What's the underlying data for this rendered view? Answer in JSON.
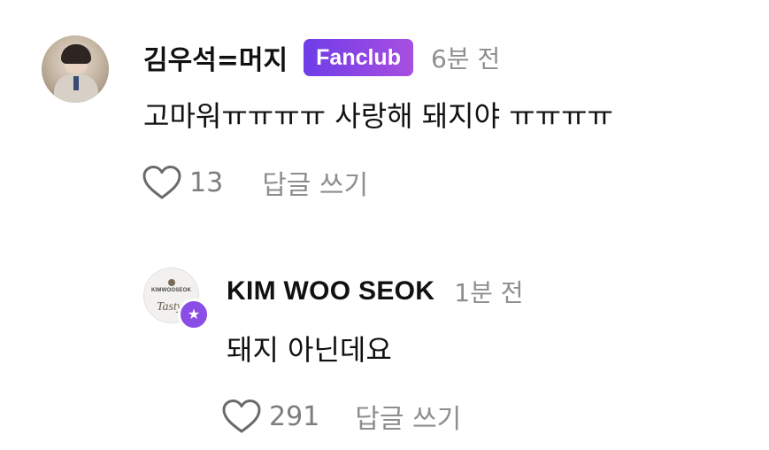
{
  "comment": {
    "author": "김우석=머지",
    "badge": "Fanclub",
    "time": "6분 전",
    "text": "고마워ㅠㅠㅠㅠ 사랑해 돼지야 ㅠㅠㅠㅠ",
    "likes": "13",
    "reply_label": "답글 쓰기"
  },
  "reply": {
    "author": "KIM WOO SEOK",
    "avatar_logo": "KIMWOOSEOK",
    "avatar_script": "Tasty",
    "time": "1분 전",
    "text": "돼지 아닌데요",
    "likes": "291",
    "reply_label": "답글 쓰기"
  },
  "colors": {
    "badge_start": "#6f3de8",
    "badge_end": "#a74fe0",
    "artist_badge": "#8a4de5",
    "muted_text": "#8e8e8e"
  },
  "icons": {
    "like": "heart-outline-icon",
    "artist": "star-icon"
  }
}
